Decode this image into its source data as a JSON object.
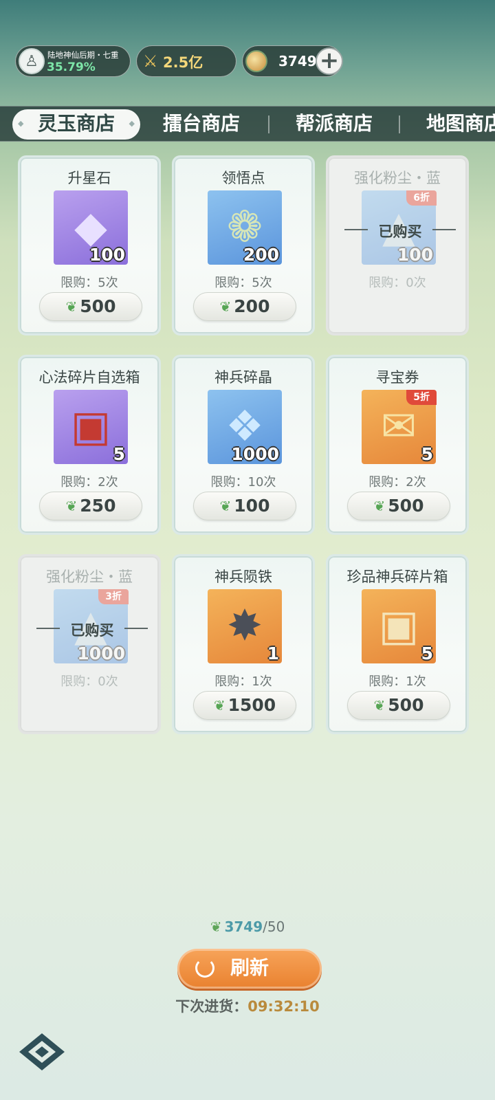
{
  "status": {
    "realm_text": "陆地神仙后期・七重",
    "realm_progress": "35.79%",
    "combat_power": "2.5亿",
    "jade_amount": "3749",
    "plus_label": "+"
  },
  "tabs": [
    {
      "label": "灵玉商店",
      "active": true
    },
    {
      "label": "擂台商店",
      "active": false
    },
    {
      "label": "帮派商店",
      "active": false
    },
    {
      "label": "地图商店",
      "active": false
    }
  ],
  "items": [
    {
      "name": "升星石",
      "qty": "100",
      "limit": "限购：5次",
      "price": "500",
      "color": "purple",
      "icon": "crystal-icon",
      "discount": "",
      "sold": false,
      "bought_label": ""
    },
    {
      "name": "领悟点",
      "qty": "200",
      "limit": "限购：5次",
      "price": "200",
      "color": "blue",
      "icon": "jade-hook-icon",
      "discount": "",
      "sold": false,
      "bought_label": ""
    },
    {
      "name": "强化粉尘・蓝",
      "qty": "100",
      "limit": "限购：0次",
      "price": "",
      "color": "blue",
      "icon": "dust-pile-icon",
      "discount": "6折",
      "sold": true,
      "bought_label": "已购买"
    },
    {
      "name": "心法碎片自选箱",
      "qty": "5",
      "limit": "限购：2次",
      "price": "250",
      "color": "purple",
      "icon": "treasure-chest-icon",
      "discount": "",
      "sold": false,
      "bought_label": ""
    },
    {
      "name": "神兵碎晶",
      "qty": "1000",
      "limit": "限购：10次",
      "price": "100",
      "color": "blue",
      "icon": "crystal-shards-icon",
      "discount": "",
      "sold": false,
      "bought_label": ""
    },
    {
      "name": "寻宝券",
      "qty": "5",
      "limit": "限购：2次",
      "price": "500",
      "color": "orange",
      "icon": "scroll-icon",
      "discount": "5折",
      "sold": false,
      "bought_label": ""
    },
    {
      "name": "强化粉尘・蓝",
      "qty": "1000",
      "limit": "限购：0次",
      "price": "",
      "color": "blue",
      "icon": "dust-pile-icon",
      "discount": "3折",
      "sold": true,
      "bought_label": "已购买"
    },
    {
      "name": "神兵陨铁",
      "qty": "1",
      "limit": "限购：1次",
      "price": "1500",
      "color": "orange",
      "icon": "meteor-iron-icon",
      "discount": "",
      "sold": false,
      "bought_label": ""
    },
    {
      "name": "珍品神兵碎片箱",
      "qty": "5",
      "limit": "限购：1次",
      "price": "500",
      "color": "orange",
      "icon": "dragon-chest-icon",
      "discount": "",
      "sold": false,
      "bought_label": ""
    }
  ],
  "footer": {
    "balance_current": "3749",
    "balance_cost": "/50",
    "refresh_label": "刷新",
    "restock_label": "下次进货：",
    "restock_time": "09:32:10"
  },
  "colors": {
    "accent_orange": "#e9812f",
    "discount_red": "#e04a3a",
    "progress_green": "#7de6a8"
  }
}
